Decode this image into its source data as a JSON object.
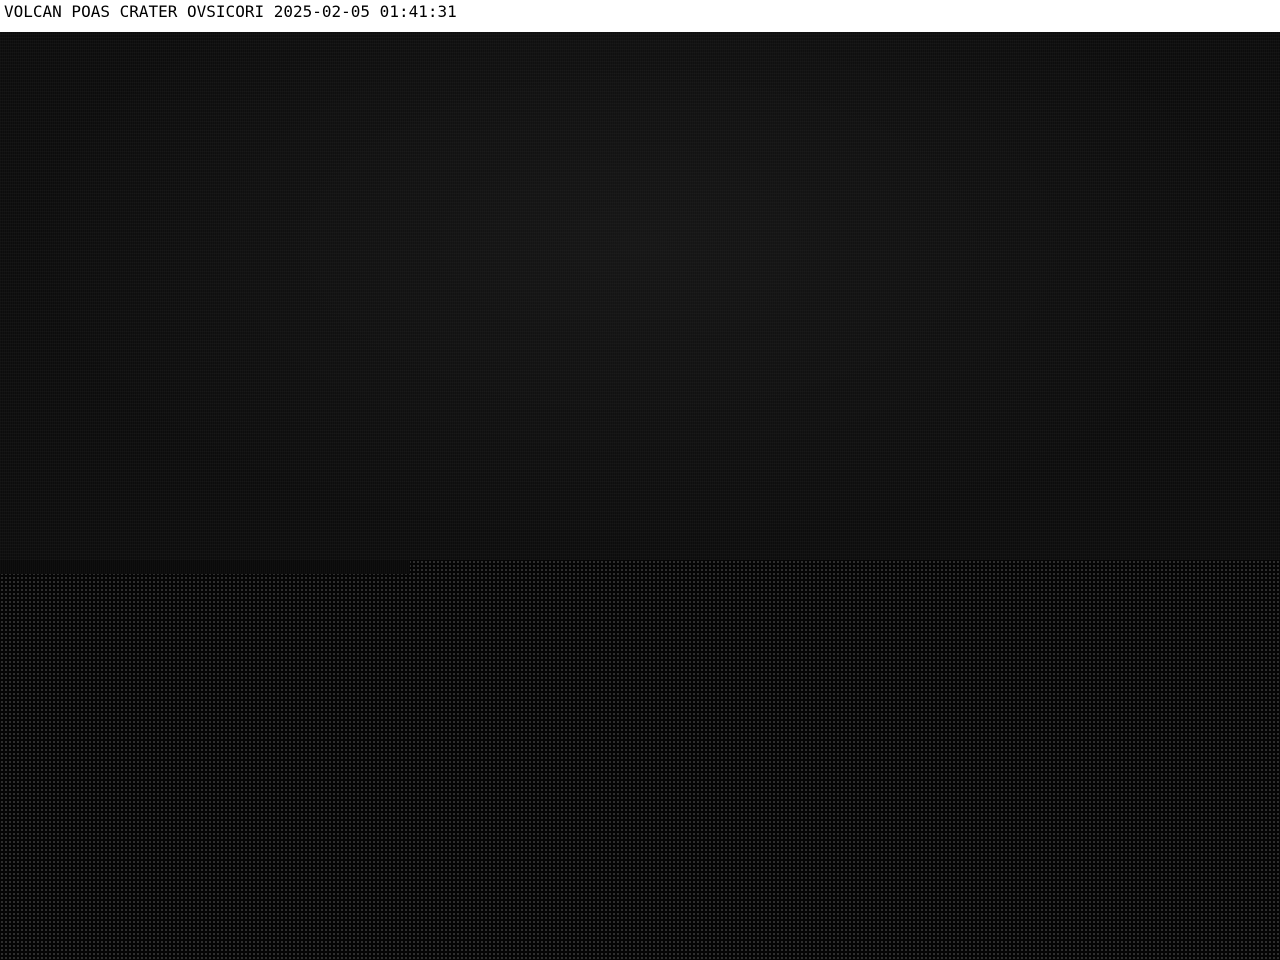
{
  "camera": {
    "caption": "VOLCAN POAS CRATER OVSICORI 2025-02-05 01:41:31"
  },
  "colors": {
    "caption_background": "#ffffff",
    "caption_text": "#000000",
    "scene": "#0c0c0c"
  }
}
